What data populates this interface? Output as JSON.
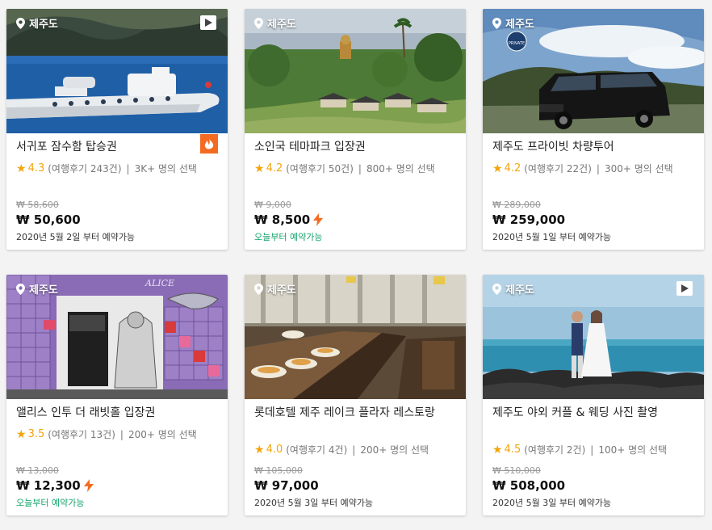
{
  "cards": [
    {
      "location": "제주도",
      "has_video": true,
      "hot_badge": true,
      "title": "서귀포 잠수함 탑승권",
      "rating": "4.3",
      "reviews": "(여행후기 243건)",
      "selected": "3K+ 명의 선택",
      "original_price": "₩ 58,600",
      "price": "₩ 50,600",
      "instant": false,
      "availability": "2020년 5월 2일 부터 예약가능",
      "availability_today": false
    },
    {
      "location": "제주도",
      "has_video": false,
      "hot_badge": false,
      "title": "소인국 테마파크 입장권",
      "rating": "4.2",
      "reviews": "(여행후기 50건)",
      "selected": "800+ 명의 선택",
      "original_price": "₩ 9,000",
      "price": "₩ 8,500",
      "instant": true,
      "availability": "오늘부터 예약가능",
      "availability_today": true
    },
    {
      "location": "제주도",
      "has_video": false,
      "hot_badge": false,
      "title": "제주도 프라이빗 차량투어",
      "rating": "4.2",
      "reviews": "(여행후기 22건)",
      "selected": "300+ 명의 선택",
      "original_price": "₩ 289,000",
      "price": "₩ 259,000",
      "instant": false,
      "availability": "2020년 5월 1일 부터 예약가능",
      "availability_today": false,
      "badge_text": "PRIVATE"
    },
    {
      "location": "제주도",
      "has_video": false,
      "hot_badge": false,
      "title": "앨리스 인투 더 래빗홀 입장권",
      "rating": "3.5",
      "reviews": "(여행후기 13건)",
      "selected": "200+ 명의 선택",
      "original_price": "₩ 13,000",
      "price": "₩ 12,300",
      "instant": true,
      "availability": "오늘부터 예약가능",
      "availability_today": true,
      "sign_text": "ALICE"
    },
    {
      "location": "제주도",
      "has_video": false,
      "hot_badge": false,
      "title": "롯데호텔 제주 레이크 플라자 레스토랑",
      "rating": "4.0",
      "reviews": "(여행후기 4건)",
      "selected": "200+ 명의 선택",
      "original_price": "₩ 105,000",
      "price": "₩ 97,000",
      "instant": false,
      "availability": "2020년 5월 3일 부터 예약가능",
      "availability_today": false
    },
    {
      "location": "제주도",
      "has_video": true,
      "hot_badge": false,
      "title": "제주도 야외 커플 & 웨딩 사진 촬영",
      "rating": "4.5",
      "reviews": "(여행후기 2건)",
      "selected": "100+ 명의 선택",
      "original_price": "₩ 510,000",
      "price": "₩ 508,000",
      "instant": false,
      "availability": "2020년 5월 3일 부터 예약가능",
      "availability_today": false
    }
  ],
  "colors": {
    "star": "#f2a50c",
    "available_today": "#12a36a",
    "hot_badge": "#f36b21",
    "bolt": "#f36b21"
  },
  "icons": {
    "location": "map-pin-icon",
    "video": "play-icon",
    "hot": "flame-icon",
    "instant": "lightning-bolt-icon",
    "star": "star-icon"
  }
}
